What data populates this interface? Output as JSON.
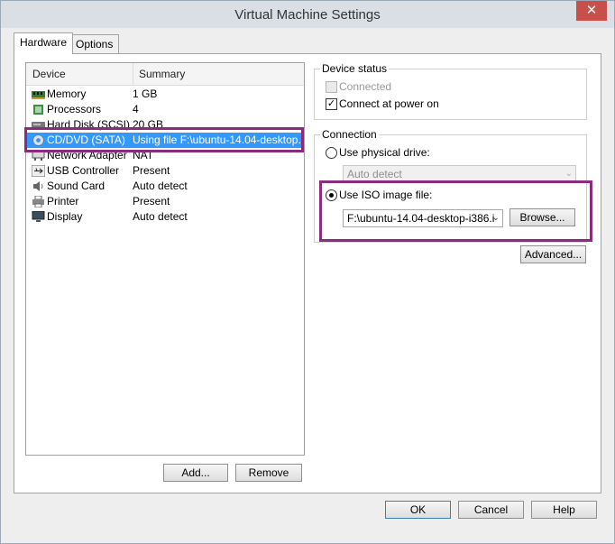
{
  "window": {
    "title": "Virtual Machine Settings",
    "close_glyph": "✕"
  },
  "tabs": [
    {
      "label": "Hardware"
    },
    {
      "label": "Options"
    }
  ],
  "device_list": {
    "headers": {
      "device": "Device",
      "summary": "Summary"
    },
    "rows": [
      {
        "name": "Memory",
        "summary": "1 GB",
        "icon": "memory-icon"
      },
      {
        "name": "Processors",
        "summary": "4",
        "icon": "processor-icon"
      },
      {
        "name": "Hard Disk (SCSI)",
        "summary": "20 GB",
        "icon": "hard-disk-icon"
      },
      {
        "name": "CD/DVD (SATA)",
        "summary": "Using file F:\\ubuntu-14.04-desktop...",
        "icon": "cd-dvd-icon",
        "selected": true
      },
      {
        "name": "Network Adapter",
        "summary": "NAT",
        "icon": "network-adapter-icon"
      },
      {
        "name": "USB Controller",
        "summary": "Present",
        "icon": "usb-icon"
      },
      {
        "name": "Sound Card",
        "summary": "Auto detect",
        "icon": "speaker-icon"
      },
      {
        "name": "Printer",
        "summary": "Present",
        "icon": "printer-icon"
      },
      {
        "name": "Display",
        "summary": "Auto detect",
        "icon": "display-icon"
      }
    ]
  },
  "list_buttons": {
    "add": "Add...",
    "remove": "Remove"
  },
  "device_status": {
    "label": "Device status",
    "connected": {
      "label": "Connected",
      "checked": false,
      "disabled": true
    },
    "connect_power_on": {
      "label": "Connect at power on",
      "checked": true
    }
  },
  "connection": {
    "label": "Connection",
    "physical_drive": {
      "label": "Use physical drive:",
      "selected": false
    },
    "physical_value": "Auto detect",
    "iso": {
      "label": "Use ISO image file:",
      "selected": true
    },
    "iso_path": "F:\\ubuntu-14.04-desktop-i386.i",
    "browse": "Browse..."
  },
  "advanced": "Advanced...",
  "footer": {
    "ok": "OK",
    "cancel": "Cancel",
    "help": "Help"
  },
  "check_glyph": "✓",
  "arrow_glyph": "⌄",
  "colors": {
    "selection": "#3399ff",
    "highlight": "#8a2b7d"
  }
}
